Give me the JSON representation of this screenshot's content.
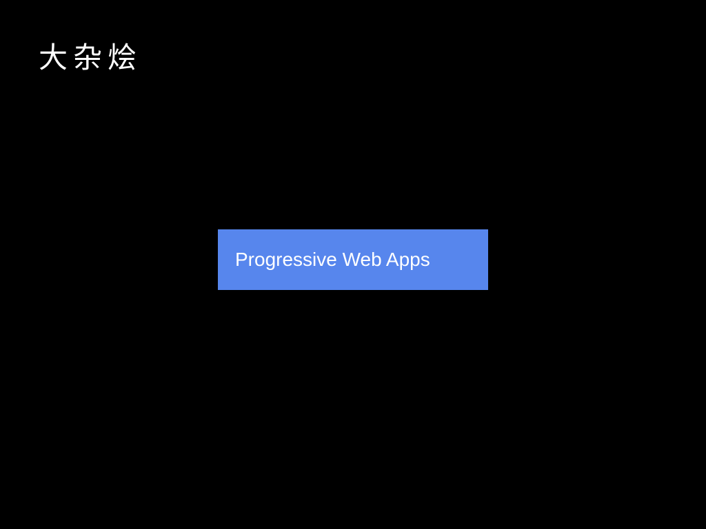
{
  "slide": {
    "title": "大杂烩",
    "banner": {
      "label": "Progressive Web Apps",
      "background_color": "#5786ed",
      "text_color": "#ffffff"
    },
    "background_color": "#000000"
  }
}
